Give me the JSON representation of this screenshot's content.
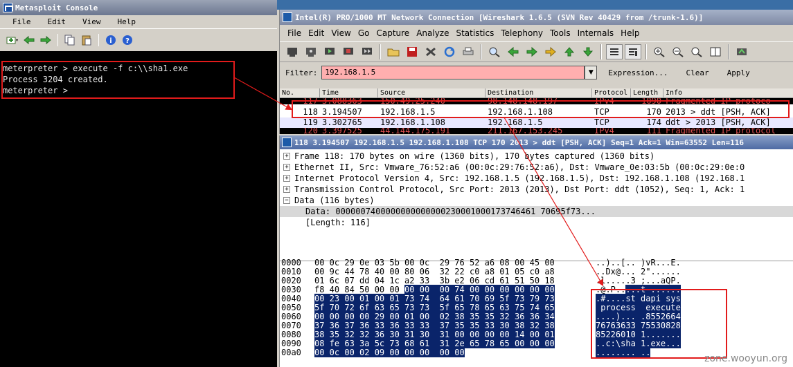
{
  "metasploit": {
    "title": "Metasploit Console",
    "menu": [
      "File",
      "Edit",
      "View",
      "Help"
    ],
    "console_lines": [
      "meterpreter > execute -f c:\\\\sha1.exe",
      "Process 3204 created.",
      "meterpreter >"
    ]
  },
  "wireshark": {
    "title": "Intel(R) PRO/1000 MT Network Connection  [Wireshark 1.6.5  (SVN Rev 40429 from /trunk-1.6)]",
    "menu": [
      "File",
      "Edit",
      "View",
      "Go",
      "Capture",
      "Analyze",
      "Statistics",
      "Telephony",
      "Tools",
      "Internals",
      "Help"
    ],
    "filter_label": "Filter:",
    "filter_value": "192.168.1.5",
    "filter_buttons": [
      "Expression...",
      "Clear",
      "Apply"
    ],
    "columns": [
      "No.",
      "Time",
      "Source",
      "Destination",
      "Protocol",
      "Length",
      "Info"
    ],
    "rows": [
      {
        "no": "117",
        "time": "3.088363",
        "src": "150.49.25.240",
        "dst": "98.148.148.197",
        "proto": "IPv4",
        "len": "1090",
        "info": "Fragmented IP protoco"
      },
      {
        "no": "118",
        "time": "3.194507",
        "src": "192.168.1.5",
        "dst": "192.168.1.108",
        "proto": "TCP",
        "len": "170",
        "info": "2013 > ddt [PSH, ACK]"
      },
      {
        "no": "119",
        "time": "3.302765",
        "src": "192.168.1.108",
        "dst": "192.168.1.5",
        "proto": "TCP",
        "len": "174",
        "info": "ddt > 2013 [PSH, ACK]"
      },
      {
        "no": "120",
        "time": "3.397525",
        "src": "44.144.175.191",
        "dst": "211.167.153.245",
        "proto": "IPv4",
        "len": "111",
        "info": "Fragmented IP protocol"
      }
    ]
  },
  "packet_detail": {
    "title": "118 3.194507 192.168.1.5 192.168.1.108 TCP 170 2013 > ddt [PSH, ACK] Seq=1 Ack=1 Win=63552 Len=116",
    "tree": [
      "Frame 118: 170 bytes on wire (1360 bits), 170 bytes captured (1360 bits)",
      "Ethernet II, Src: Vmware_76:52:a6 (00:0c:29:76:52:a6), Dst: Vmware_0e:03:5b (00:0c:29:0e:0",
      "Internet Protocol Version 4, Src: 192.168.1.5 (192.168.1.5), Dst: 192.168.1.108 (192.168.1",
      "Transmission Control Protocol, Src Port: 2013 (2013), Dst Port: ddt (1052), Seq: 1, Ack: 1",
      "Data (116 bytes)"
    ],
    "data_line": "Data: 0000007400000000000000230001000173746461 70695f73...",
    "length_line": "[Length: 116]",
    "hex_rows": [
      {
        "off": "0000",
        "pre": "00 0c 29 0e 03 5b 00 0c  29 76 52 a6 08 00 45 00",
        "hl": "",
        "ascii_pre": "..)..[.. )vR...E.",
        "ascii_hl": ""
      },
      {
        "off": "0010",
        "pre": "00 9c 44 78 40 00 80 06  32 22 c0 a8 01 05 c0 a8",
        "hl": "",
        "ascii_pre": "..Dx@... 2\"......",
        "ascii_hl": ""
      },
      {
        "off": "0020",
        "pre": "01 6c 07 dd 04 1c a2 33  3b e2 06 cd 61 51 50 18",
        "hl": "",
        "ascii_pre": ".l.....3 ;...aQP.",
        "ascii_hl": ""
      },
      {
        "off": "0030",
        "pre": "f8 40 84 50 00 00 ",
        "hl": "00 00  00 74 00 00 00 00 00 00",
        "ascii_pre": ".@.P..",
        "ascii_hl": "...t ......"
      },
      {
        "off": "0040",
        "pre": "",
        "hl": "00 23 00 01 00 01 73 74  64 61 70 69 5f 73 79 73",
        "ascii_pre": "",
        "ascii_hl": ".#....st dapi_sys"
      },
      {
        "off": "0050",
        "pre": "",
        "hl": "5f 70 72 6f 63 65 73 73  5f 65 78 65 63 75 74 65",
        "ascii_pre": "",
        "ascii_hl": "_process _execute"
      },
      {
        "off": "0060",
        "pre": "",
        "hl": "00 00 00 00 29 00 01 00  02 38 35 35 32 36 36 34",
        "ascii_pre": "",
        "ascii_hl": "....)... .8552664"
      },
      {
        "off": "0070",
        "pre": "",
        "hl": "37 36 37 36 33 36 33 33  37 35 35 33 30 38 32 38",
        "ascii_pre": "",
        "ascii_hl": "76763633 75530828"
      },
      {
        "off": "0080",
        "pre": "",
        "hl": "38 35 32 32 36 30 31 30  31 00 00 00 00 14 00 01",
        "ascii_pre": "",
        "ascii_hl": "85226010 1......."
      },
      {
        "off": "0090",
        "pre": "",
        "hl": "08 fe 63 3a 5c 73 68 61  31 2e 65 78 65 00 00 00",
        "ascii_pre": "",
        "ascii_hl": "..c:\\sha 1.exe..."
      },
      {
        "off": "00a0",
        "pre": "",
        "hl": "00 0c 00 02 09 00 00 00  00 00",
        "ascii_pre": "",
        "ascii_hl": "........ .."
      }
    ]
  },
  "watermark": "zone.wooyun.org",
  "colors": {
    "highlight_red": "#e21b1b",
    "filter_bg": "#ffafaf",
    "selection": "#0a246a"
  }
}
